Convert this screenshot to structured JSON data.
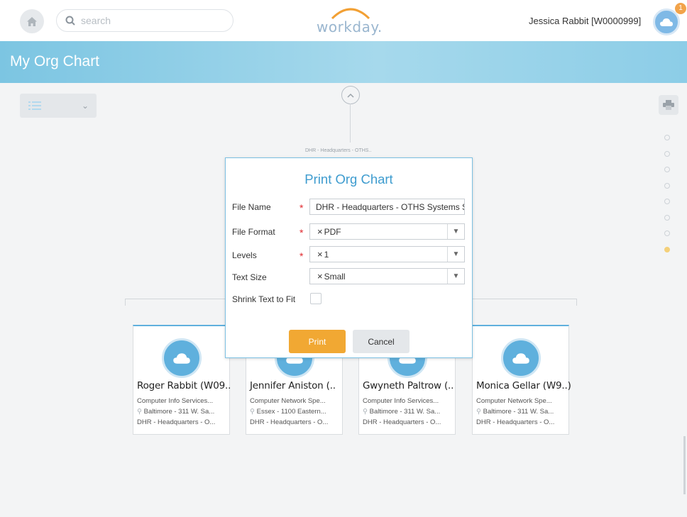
{
  "header": {
    "search_placeholder": "search",
    "logo_text": "workday.",
    "user_name": "Jessica Rabbit [W0000999]",
    "notification_count": "1"
  },
  "page": {
    "title": "My Org Chart",
    "org_root_label": "DHR - Headquarters - OTHS..",
    "pagination_dots": 8,
    "active_dot": 8
  },
  "dialog": {
    "title": "Print Org Chart",
    "file_name_label": "File Name",
    "file_name_value": "DHR - Headquarters - OTHS Systems Se",
    "file_format_label": "File Format",
    "file_format_value": "PDF",
    "levels_label": "Levels",
    "levels_value": "1",
    "text_size_label": "Text Size",
    "text_size_value": "Small",
    "shrink_label": "Shrink Text to Fit",
    "shrink_checked": false,
    "print_label": "Print",
    "cancel_label": "Cancel",
    "required_mark": "*",
    "remove_mark": "×",
    "dropdown_mark": "▼"
  },
  "cards": [
    {
      "name": "Roger Rabbit (W09..",
      "title": "Computer Info Services...",
      "location": "Baltimore - 311 W. Sa...",
      "org": "DHR - Headquarters - O..."
    },
    {
      "name": "Jennifer Aniston (..",
      "title": "Computer Network Spe...",
      "location": "Essex - 1100 Eastern...",
      "org": "DHR - Headquarters - O..."
    },
    {
      "name": "Gwyneth Paltrow (..",
      "title": "Computer Info Services...",
      "location": "Baltimore - 311 W. Sa...",
      "org": "DHR - Headquarters - O..."
    },
    {
      "name": "Monica Gellar (W9..)",
      "title": "Computer Network Spe...",
      "location": "Baltimore - 311 W. Sa...",
      "org": "DHR - Headquarters - O..."
    }
  ],
  "colors": {
    "banner": "#7cc5e2",
    "accent_blue": "#3e9ccf",
    "print_button": "#f1a833",
    "required": "#e0282d"
  }
}
